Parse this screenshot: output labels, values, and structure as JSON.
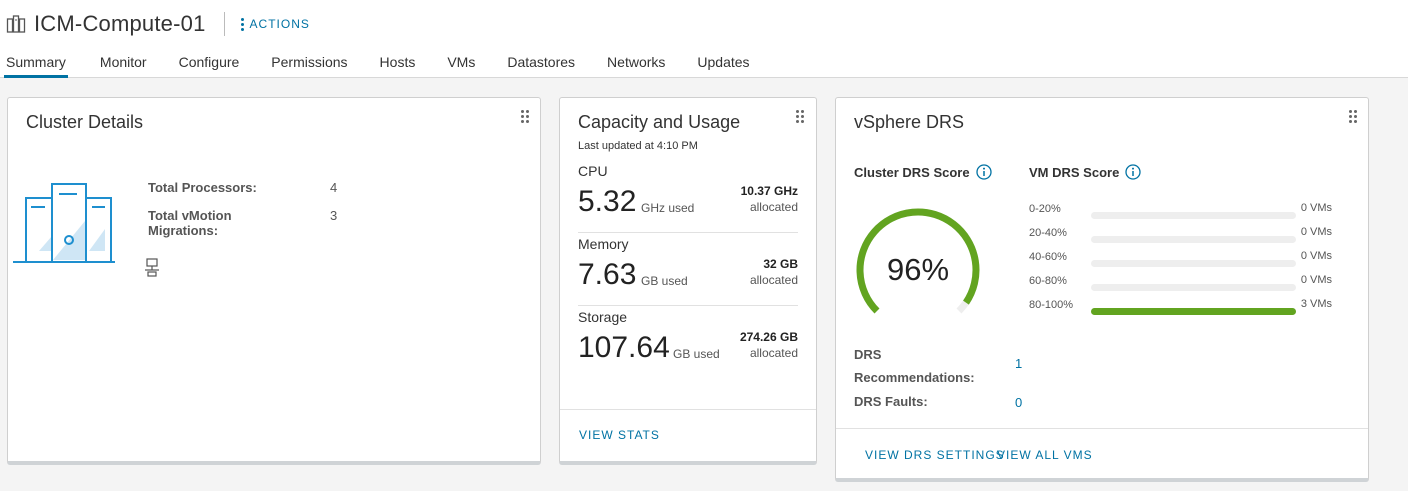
{
  "header": {
    "title": "ICM-Compute-01",
    "actions_label": "ACTIONS",
    "tabs": [
      {
        "label": "Summary",
        "active": true
      },
      {
        "label": "Monitor"
      },
      {
        "label": "Configure"
      },
      {
        "label": "Permissions"
      },
      {
        "label": "Hosts"
      },
      {
        "label": "VMs"
      },
      {
        "label": "Datastores"
      },
      {
        "label": "Networks"
      },
      {
        "label": "Updates"
      }
    ]
  },
  "details": {
    "title": "Cluster Details",
    "rows": [
      {
        "label": "Total Processors:",
        "value": "4"
      },
      {
        "label": "Total vMotion Migrations:",
        "value": "3"
      }
    ]
  },
  "capacity": {
    "title": "Capacity and Usage",
    "last_updated": "Last updated at 4:10 PM",
    "resources": [
      {
        "name": "CPU",
        "used": "5.32",
        "used_unit": "GHz used",
        "allocated": "10.37 GHz",
        "allocated_label": "allocated"
      },
      {
        "name": "Memory",
        "used": "7.63",
        "used_unit": "GB used",
        "allocated": "32 GB",
        "allocated_label": "allocated"
      },
      {
        "name": "Storage",
        "used": "107.64",
        "used_unit": "GB used",
        "allocated": "274.26 GB",
        "allocated_label": "allocated"
      }
    ],
    "view_stats": "VIEW STATS"
  },
  "drs": {
    "title": "vSphere DRS",
    "cluster_score_label": "Cluster DRS Score",
    "vm_score_label": "VM DRS Score",
    "score_text": "96%",
    "score_value": 96,
    "distribution": [
      {
        "range": "0-20%",
        "count": "0 VMs",
        "fraction": 0
      },
      {
        "range": "20-40%",
        "count": "0 VMs",
        "fraction": 0
      },
      {
        "range": "40-60%",
        "count": "0 VMs",
        "fraction": 0
      },
      {
        "range": "60-80%",
        "count": "0 VMs",
        "fraction": 0
      },
      {
        "range": "80-100%",
        "count": "3 VMs",
        "fraction": 1
      }
    ],
    "recommendations_label": "DRS Recommendations:",
    "recommendations_value": "1",
    "faults_label": "DRS Faults:",
    "faults_value": "0",
    "view_settings": "VIEW DRS SETTINGS",
    "view_all_vms": "VIEW ALL VMS"
  },
  "colors": {
    "accent": "#0072a3",
    "score_green": "#62a420",
    "track": "#eeeeee"
  }
}
